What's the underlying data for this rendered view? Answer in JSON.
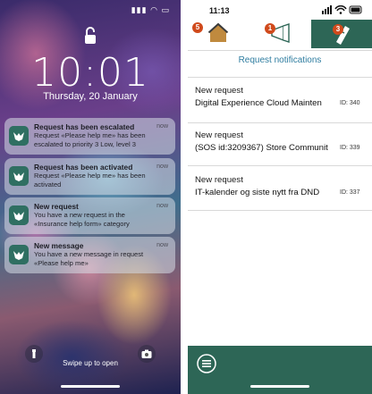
{
  "lockscreen": {
    "time": "10:01",
    "date": "Thursday, 20 January",
    "swipe_text": "Swipe up to open",
    "notifications": [
      {
        "title": "Request has been escalated",
        "time": "now",
        "body": "Request «Please help me» has been escalated to priority 3 Low, level 3"
      },
      {
        "title": "Request has been activated",
        "time": "now",
        "body": "Request «Please help me» has been activated"
      },
      {
        "title": "New request",
        "time": "now",
        "body": "You have a new request in the «Insurance help form» category"
      },
      {
        "title": "New message",
        "time": "now",
        "body": "You have a new message in request «Please help me»"
      }
    ]
  },
  "app": {
    "status_time": "11:13",
    "tabs": [
      {
        "icon": "home-icon",
        "badge": "5"
      },
      {
        "icon": "megaphone-icon",
        "badge": "1"
      },
      {
        "icon": "ticket-icon",
        "badge": "3"
      }
    ],
    "section_title": "Request notifications",
    "requests": [
      {
        "label": "New request",
        "name": "Digital Experience Cloud Mainten",
        "id": "ID: 340"
      },
      {
        "label": "New request",
        "name": "(SOS id:3209367) Store Communit",
        "id": "ID: 339"
      },
      {
        "label": "New request",
        "name": "IT-kalender og siste nytt fra DND",
        "id": "ID: 337"
      }
    ],
    "colors": {
      "brand": "#2d6656",
      "badge": "#d04a1c",
      "link": "#2f7da0"
    }
  }
}
